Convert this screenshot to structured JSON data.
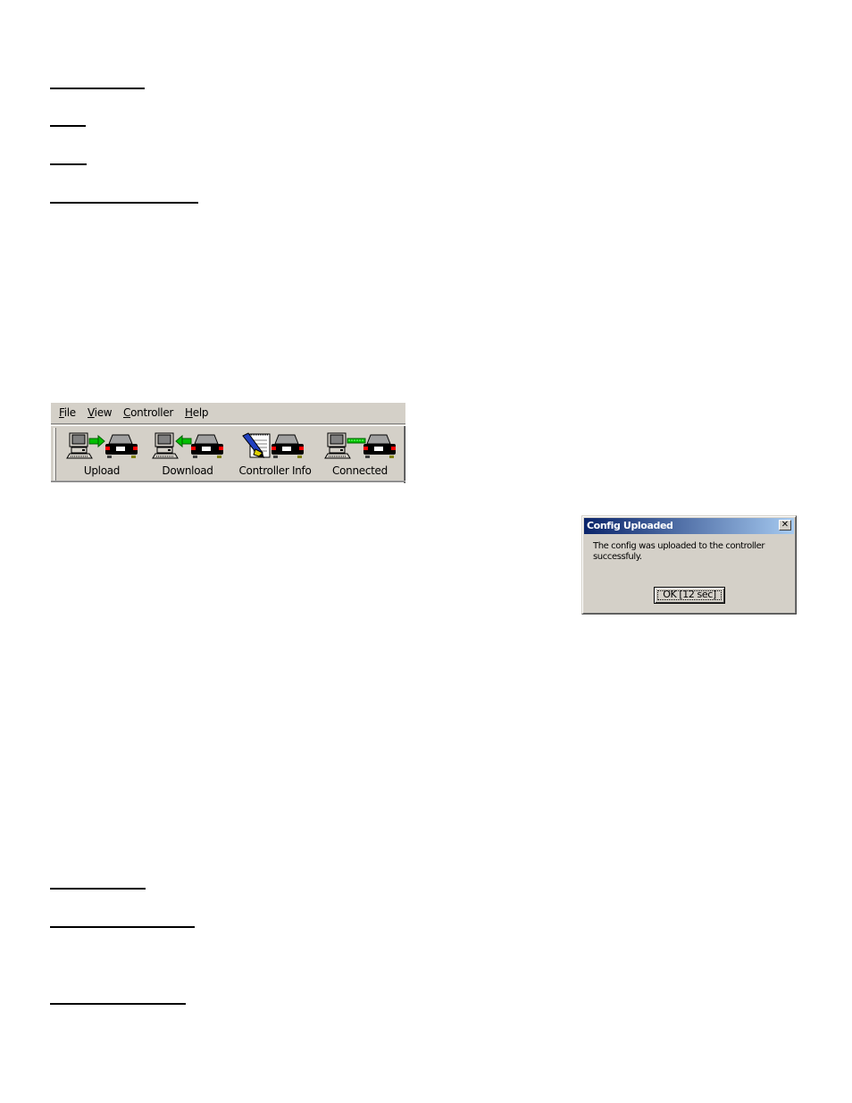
{
  "document": {
    "headings_top": [
      "",
      "",
      "",
      ""
    ],
    "headings_bottom": [
      "",
      "",
      ""
    ]
  },
  "app": {
    "menu": [
      {
        "label_acc": "F",
        "label_rest": "ile"
      },
      {
        "label_acc": "V",
        "label_rest": "iew"
      },
      {
        "label_acc": "C",
        "label_rest": "ontroller"
      },
      {
        "label_acc": "H",
        "label_rest": "elp"
      }
    ],
    "toolbar": [
      {
        "label": "Upload",
        "icon": "computer-to-car-arrow-icon"
      },
      {
        "label": "Download",
        "icon": "car-to-computer-arrow-icon"
      },
      {
        "label": "Controller Info",
        "icon": "notepad-pen-car-icon"
      },
      {
        "label": "Connected",
        "icon": "computer-car-link-icon"
      }
    ],
    "colors": {
      "arrow_green": "#00c000",
      "car_red": "#ff0000",
      "window_bg": "#d4d0c8",
      "title_start": "#0a246a",
      "title_end": "#a6caf0"
    }
  },
  "dialog": {
    "title": "Config Uploaded",
    "close_glyph": "✕",
    "message": "The config was uploaded to the controller successfuly.",
    "ok_label": "OK [12 sec]"
  }
}
